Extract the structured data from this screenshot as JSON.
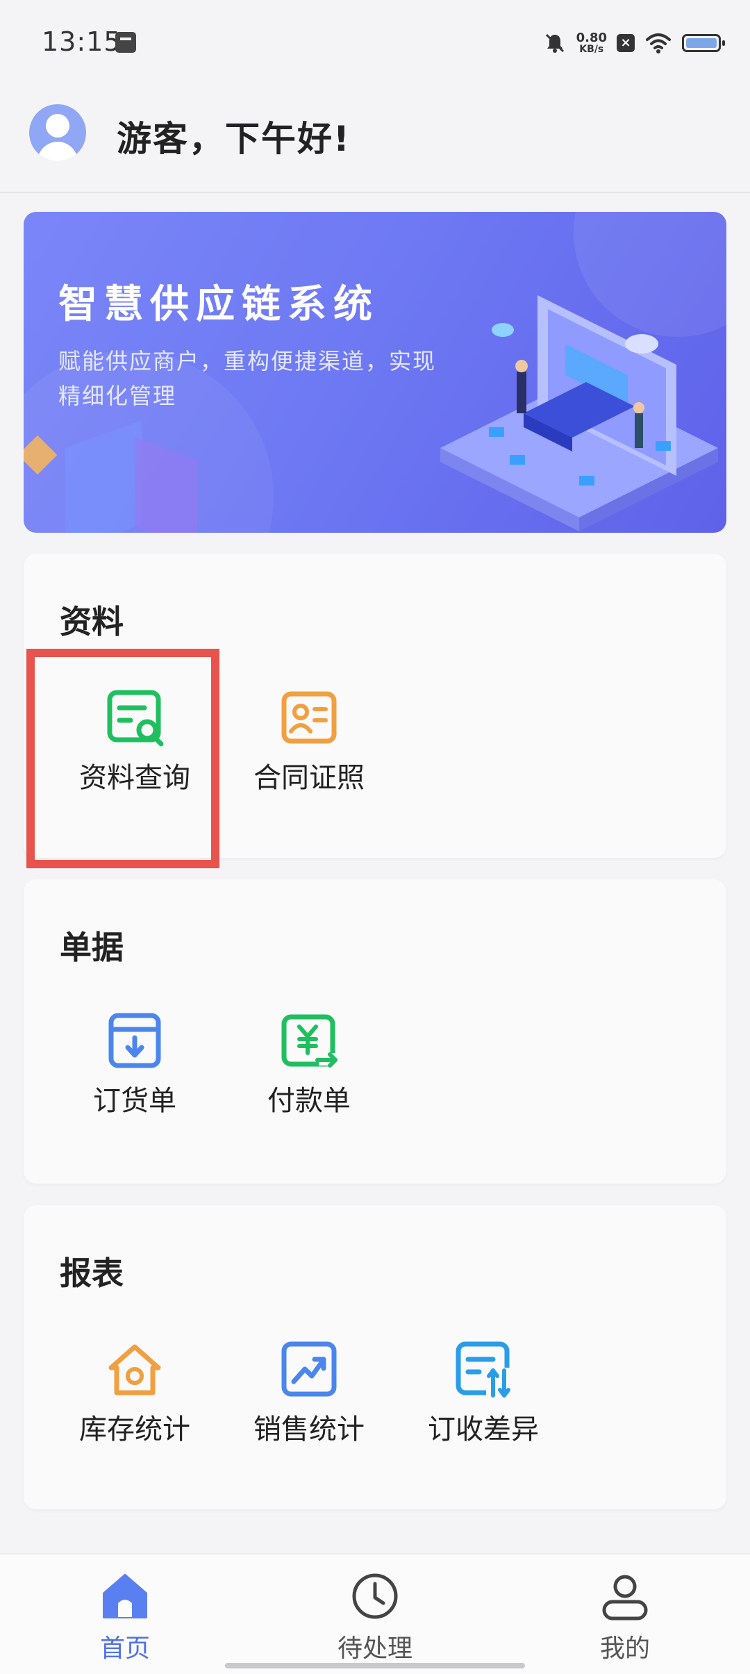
{
  "status_bar": {
    "time": "13:15",
    "speed_value": "0.80",
    "speed_unit": "KB/s",
    "icons": [
      "sim-card-icon",
      "mute-bell-icon",
      "close-box-icon",
      "wifi-icon",
      "battery-icon"
    ]
  },
  "header": {
    "greeting": "游客，下午好!"
  },
  "banner": {
    "title": "智慧供应链系统",
    "subtitle": "赋能供应商户，重构便捷渠道，实现精细化管理"
  },
  "sections": [
    {
      "title": "资料",
      "items": [
        {
          "label": "资料查询",
          "icon": "doc-search-icon",
          "color": "#1fbf5f"
        },
        {
          "label": "合同证照",
          "icon": "id-card-icon",
          "color": "#f0a040"
        }
      ]
    },
    {
      "title": "单据",
      "items": [
        {
          "label": "订货单",
          "icon": "download-box-icon",
          "color": "#4a86ec"
        },
        {
          "label": "付款单",
          "icon": "yuan-transfer-icon",
          "color": "#1fbf5f"
        }
      ]
    },
    {
      "title": "报表",
      "items": [
        {
          "label": "库存统计",
          "icon": "house-icon",
          "color": "#f0a040"
        },
        {
          "label": "销售统计",
          "icon": "trend-up-icon",
          "color": "#4a86ec"
        },
        {
          "label": "订收差异",
          "icon": "doc-sort-icon",
          "color": "#2a9de8"
        }
      ]
    }
  ],
  "bottom_nav": [
    {
      "label": "首页",
      "icon": "home-icon",
      "active": true
    },
    {
      "label": "待处理",
      "icon": "clock-icon",
      "active": false
    },
    {
      "label": "我的",
      "icon": "user-icon",
      "active": false
    }
  ],
  "colors": {
    "accent": "#4f70ec",
    "highlight": "#e8534d",
    "banner": "#6e79f3"
  }
}
